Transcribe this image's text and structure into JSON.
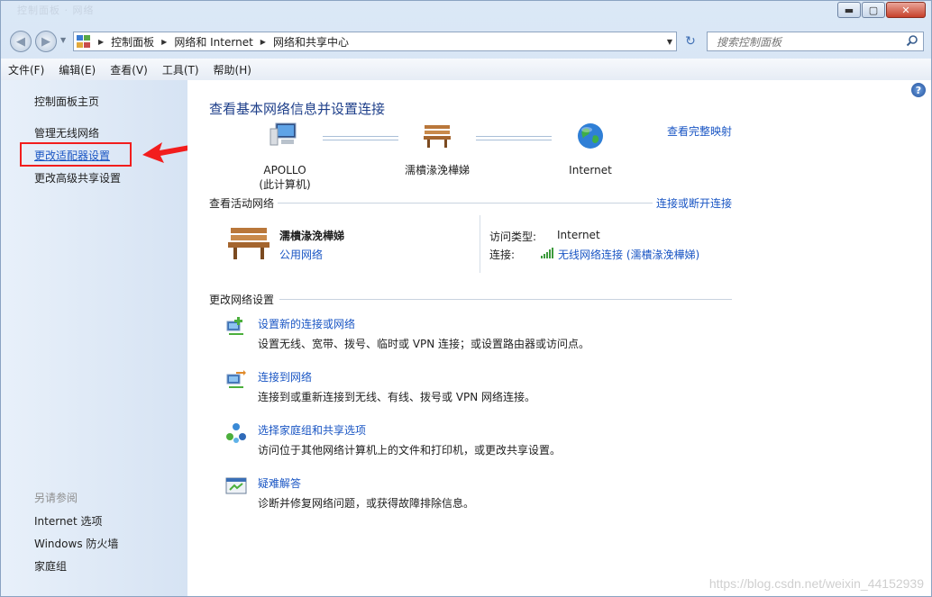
{
  "window": {
    "title_ghost": "控制面板 · 网络",
    "min_label": "▬",
    "max_label": "▢",
    "close_label": "✕"
  },
  "address": {
    "crumbs": [
      "控制面板",
      "网络和 Internet",
      "网络和共享中心"
    ],
    "search_placeholder": "搜索控制面板"
  },
  "menu": [
    "文件(F)",
    "编辑(E)",
    "查看(V)",
    "工具(T)",
    "帮助(H)"
  ],
  "sidebar": {
    "home": "控制面板主页",
    "items": [
      "管理无线网络",
      "更改适配器设置",
      "更改高级共享设置"
    ],
    "see_also_label": "另请参阅",
    "see_also": [
      "Internet 选项",
      "Windows 防火墙",
      "家庭组"
    ]
  },
  "main": {
    "header": "查看基本网络信息并设置连接",
    "map_link": "查看完整映射",
    "nodes": [
      {
        "line1": "APOLLO",
        "line2": "(此计算机)"
      },
      {
        "line1": "濡樻湪浼樺娣",
        "line2": ""
      },
      {
        "line1": "Internet",
        "line2": ""
      }
    ],
    "active_label": "查看活动网络",
    "connect_link": "连接或断开连接",
    "network_name": "濡樻湪浼樺娣",
    "network_type": "公用网络",
    "access_label": "访问类型:",
    "access_value": "Internet",
    "conn_label": "连接:",
    "conn_value": "无线网络连接 (濡樻湪浼樺娣)",
    "change_label": "更改网络设置",
    "tasks": [
      {
        "title": "设置新的连接或网络",
        "desc": "设置无线、宽带、拨号、临时或 VPN 连接；或设置路由器或访问点。",
        "icon": "new-connection-icon"
      },
      {
        "title": "连接到网络",
        "desc": "连接到或重新连接到无线、有线、拨号或 VPN 网络连接。",
        "icon": "connect-network-icon"
      },
      {
        "title": "选择家庭组和共享选项",
        "desc": "访问位于其他网络计算机上的文件和打印机，或更改共享设置。",
        "icon": "homegroup-icon"
      },
      {
        "title": "疑难解答",
        "desc": "诊断并修复网络问题，或获得故障排除信息。",
        "icon": "troubleshoot-icon"
      }
    ]
  },
  "watermark": "https://blog.csdn.net/weixin_44152939"
}
